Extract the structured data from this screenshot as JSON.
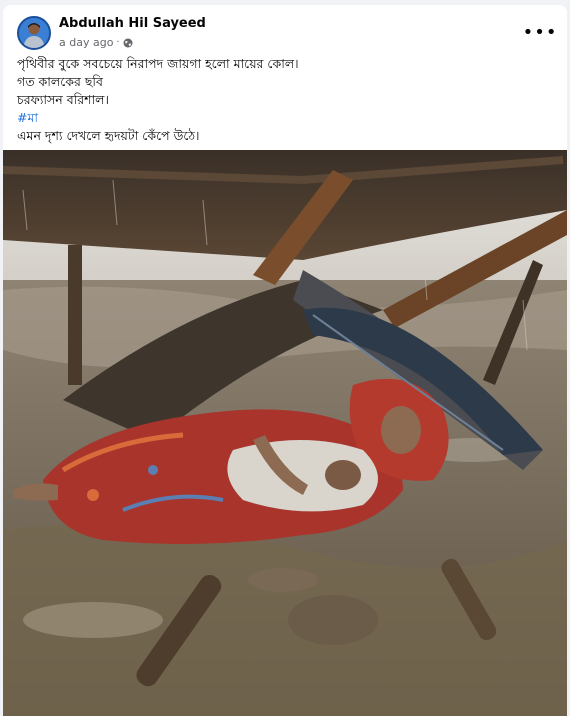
{
  "post": {
    "author": "Abdullah Hil Sayeed",
    "time": "a day ago",
    "separator": "·",
    "more_label": "•••",
    "lines": {
      "l1": "পৃথিবীর বুকে সবচেয়ে নিরাপদ জায়গা হলো মায়ের কোল।",
      "l2": "গত  কালকের ছবি",
      "l3": "চরফ্যাসন বরিশাল।",
      "hashtag": "#মা",
      "l5": "এমন দৃশ্য দেখলে হৃদয়টা কেঁপে উঠে।"
    }
  },
  "icons": {
    "privacy": "globe-icon",
    "options": "more-options-icon"
  },
  "colors": {
    "background": "#f0f2f5",
    "card": "#ffffff",
    "hashtag": "#216fdb",
    "meta": "#65676b"
  }
}
